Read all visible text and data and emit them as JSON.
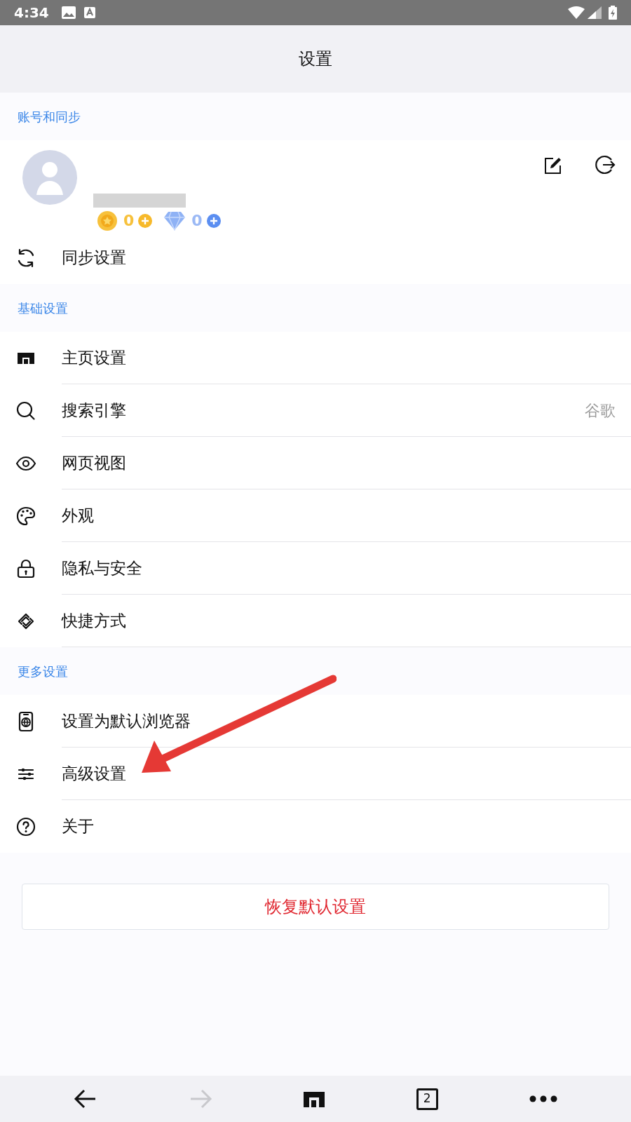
{
  "status_bar": {
    "time": "4:34"
  },
  "header": {
    "title": "设置"
  },
  "account": {
    "section": "账号和同步",
    "coins": "0",
    "diamonds": "0"
  },
  "sync_row": {
    "label": "同步设置"
  },
  "sections": [
    {
      "title": "基础设置",
      "items": [
        {
          "label": "主页设置"
        },
        {
          "label": "搜索引擎",
          "value": "谷歌"
        },
        {
          "label": "网页视图"
        },
        {
          "label": "外观"
        },
        {
          "label": "隐私与安全"
        },
        {
          "label": "快捷方式"
        }
      ]
    },
    {
      "title": "更多设置",
      "items": [
        {
          "label": "设置为默认浏览器"
        },
        {
          "label": "高级设置"
        },
        {
          "label": "关于"
        }
      ]
    }
  ],
  "reset_button": "恢复默认设置",
  "bottom_bar": {
    "back_disabled": false,
    "forward_disabled": true,
    "tab_count": "2"
  }
}
